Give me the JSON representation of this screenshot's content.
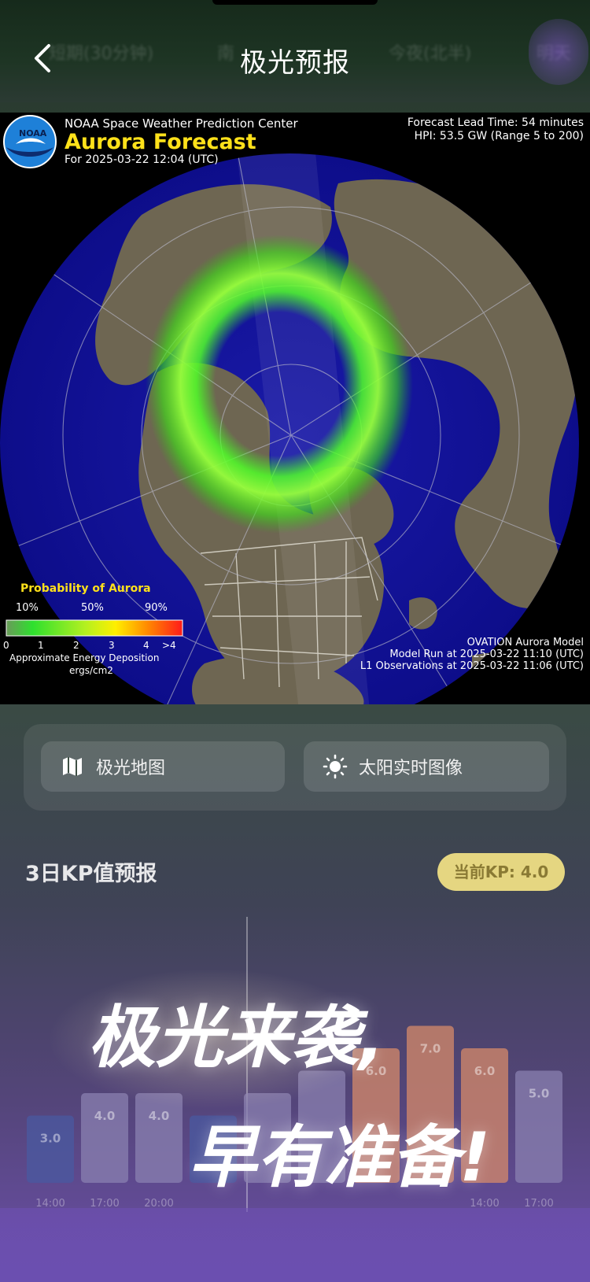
{
  "header": {
    "title": "极光预报",
    "ghost_tabs": [
      "短期(30分钟)",
      "南",
      "今夜(北半)",
      "明天"
    ]
  },
  "map": {
    "agency": "NOAA Space Weather Prediction Center",
    "logo_text": "NOAA",
    "headline": "Aurora Forecast",
    "date_line": "For 2025-03-22 12:04 (UTC)",
    "lead_time": "Forecast Lead Time:  54 minutes",
    "hpi": "HPI:  53.5 GW (Range 5 to 200)",
    "legend_title": "Probability of Aurora",
    "legend_pct": [
      "10%",
      "50%",
      "90%"
    ],
    "legend_ticks": [
      "0",
      "1",
      "2",
      "3",
      "4",
      ">4"
    ],
    "legend_caption1": "Approximate Energy Deposition",
    "legend_caption2": "ergs/cm2",
    "model_name": "OVATION Aurora Model",
    "model_run": "Model Run at 2025-03-22 11:10 (UTC)",
    "observations": "L1 Observations at 2025-03-22 11:06 (UTC)"
  },
  "buttons": {
    "aurora_map": "极光地图",
    "sun_images": "太阳实时图像"
  },
  "kp": {
    "title": "3日KP值预报",
    "current": "当前KP: 4.0"
  },
  "chart_data": {
    "type": "bar",
    "values": [
      3.0,
      4.0,
      4.0,
      3.0,
      4.0,
      5.0,
      6.0,
      7.0,
      6.0,
      5.0
    ],
    "labels": [
      "3.0",
      "4.0",
      "4.0",
      "",
      "",
      "",
      "6.0",
      "7.0",
      "6.0",
      "5.0"
    ],
    "times": [
      "14:00",
      "17:00",
      "20:00",
      "",
      "",
      "",
      "",
      "",
      "14:00",
      "17:00"
    ],
    "colors": {
      "low": "#4a5aa0",
      "mid": "#8a80b0",
      "high": "#d68a6a"
    }
  },
  "overlay": {
    "line1": "极光来袭,",
    "line2": "早有准备!"
  }
}
